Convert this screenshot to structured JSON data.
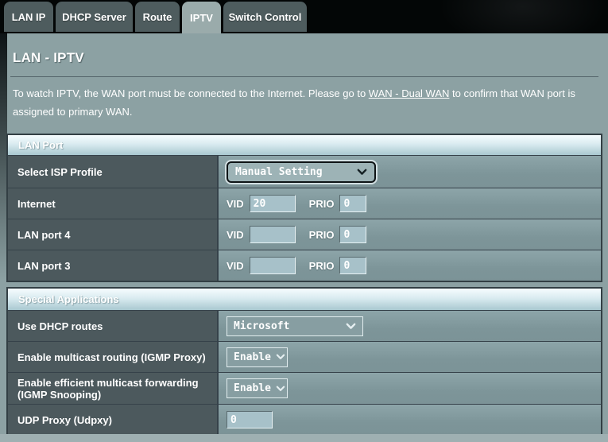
{
  "colors": {
    "content_bg": "#8ca1a3",
    "topbar_bg": "#030606",
    "tab_bg": "#4e5c5e",
    "tab_active_bg": "#9aabab",
    "label_cell_bg": "#4c595d",
    "value_cell_bg": "#7d9599",
    "header_gradient_top": "#f6fcfe",
    "header_gradient_bottom": "#a9c8d0",
    "input_bg": "#a7c1c9",
    "text": "#ffffff"
  },
  "tabs": [
    {
      "label": "LAN IP",
      "active": false
    },
    {
      "label": "DHCP Server",
      "active": false
    },
    {
      "label": "Route",
      "active": false
    },
    {
      "label": "IPTV",
      "active": true
    },
    {
      "label": "Switch Control",
      "active": false
    }
  ],
  "page": {
    "title": "LAN - IPTV",
    "desc_before_link": "To watch IPTV, the WAN port must be connected to the Internet. Please go to ",
    "desc_link": "WAN - Dual WAN",
    "desc_after_link": " to confirm that WAN port is assigned to primary WAN."
  },
  "lan_port": {
    "header": "LAN Port",
    "vid_label": "VID",
    "prio_label": "PRIO",
    "isp_profile": {
      "label": "Select ISP Profile",
      "value": "Manual Setting",
      "icon": "chevron-down-icon"
    },
    "rows": [
      {
        "label": "Internet",
        "vid": "20",
        "prio": "0"
      },
      {
        "label": "LAN port 4",
        "vid": "",
        "prio": "0"
      },
      {
        "label": "LAN port 3",
        "vid": "",
        "prio": "0"
      }
    ]
  },
  "special_apps": {
    "header": "Special Applications",
    "rows": [
      {
        "label": "Use DHCP routes",
        "control": "select",
        "value": "Microsoft",
        "icon": "chevron-down-icon"
      },
      {
        "label": "Enable multicast routing (IGMP Proxy)",
        "control": "select",
        "value": "Enable",
        "icon": "chevron-down-icon"
      },
      {
        "label": "Enable efficient multicast forwarding (IGMP Snooping)",
        "control": "select",
        "value": "Enable",
        "icon": "chevron-down-icon"
      },
      {
        "label": "UDP Proxy (Udpxy)",
        "control": "input",
        "value": "0"
      }
    ]
  }
}
